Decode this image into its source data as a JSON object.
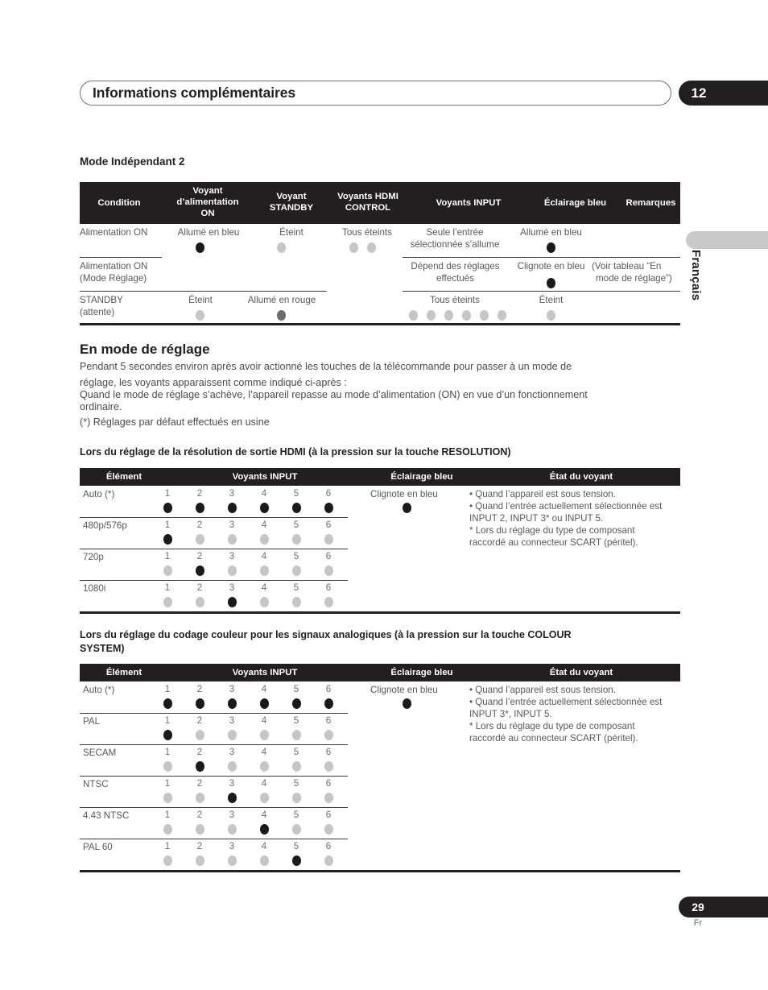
{
  "header": {
    "title": "Informations complémentaires",
    "chapter": "12"
  },
  "side_tab": {
    "language": "Français"
  },
  "footer": {
    "page_number": "29",
    "language_code": "Fr"
  },
  "section_mode_independant": {
    "title": "Mode Indépendant 2",
    "table": {
      "headers": [
        "Condition",
        "Voyant\nd’alimentation\nON",
        "Voyant\nSTANDBY",
        "Voyants HDMI\nCONTROL",
        "Voyants INPUT",
        "Éclairage bleu",
        "Remarques"
      ],
      "header_lines": {
        "h0": [
          "Condition"
        ],
        "h1": [
          "Voyant",
          "d’alimentation",
          "ON"
        ],
        "h2": [
          "Voyant",
          "STANDBY"
        ],
        "h3": [
          "Voyants HDMI",
          "CONTROL"
        ],
        "h4": [
          "Voyants INPUT"
        ],
        "h5": [
          "Éclairage bleu"
        ],
        "h6": [
          "Remarques"
        ]
      },
      "rows": [
        {
          "condition": [
            "Alimentation ON"
          ],
          "power": "Allumé en bleu",
          "standby": "Éteint",
          "hdmi": "Tous éteints",
          "input": [
            "Seule l’entrée",
            "sélectionnée s’allume"
          ],
          "blue": "Allumé en bleu",
          "remarks": [
            ""
          ],
          "power_dot": "on",
          "standby_dot": "off",
          "hdmi_dots": [
            "off",
            "off"
          ],
          "input_dots": [],
          "blue_dot": "on"
        },
        {
          "condition": [
            "Alimentation ON",
            "(Mode Réglage)"
          ],
          "power": "",
          "standby": "",
          "hdmi": "",
          "input": [
            "Dépend des réglages",
            "effectués"
          ],
          "blue": "Clignote en bleu",
          "remarks": [
            "(Voir tableau “En",
            "mode de réglage”)"
          ],
          "power_dot": "none",
          "standby_dot": "none",
          "hdmi_dots": [],
          "input_dots": [],
          "blue_dot": "on"
        },
        {
          "condition": [
            "STANDBY",
            "(attente)"
          ],
          "power": "Éteint",
          "standby": "Allumé en rouge",
          "hdmi": "",
          "input": [
            "Tous éteints"
          ],
          "blue": "Éteint",
          "remarks": [
            ""
          ],
          "power_dot": "off",
          "standby_dot": "red",
          "hdmi_dots": [],
          "input_dots": [
            "off",
            "off",
            "off",
            "off",
            "off",
            "off"
          ],
          "blue_dot": "off"
        }
      ]
    }
  },
  "section_en_mode_de_reglage": {
    "title": "En mode de réglage",
    "paragraph_lines": [
      "Pendant 5 secondes environ après avoir actionné les touches de la télécommande pour passer à un mode de",
      "réglage, les voyants apparaissent comme indiqué ci-après :",
      "Quand le mode de réglage s’achève, l’appareil repasse au mode d’alimentation (ON) en vue d’un fonctionnement",
      "ordinaire.",
      "(*) Réglages par défaut effectués en usine"
    ]
  },
  "section_resolution": {
    "title_lines": [
      "Lors du réglage de la résolution de sortie HDMI (à la pression sur la touche RESOLUTION)"
    ],
    "table": {
      "headers": [
        "Élément",
        "Voyants INPUT",
        "Éclairage bleu",
        "État du voyant"
      ],
      "input_numbers": [
        "1",
        "2",
        "3",
        "4",
        "5",
        "6"
      ],
      "rows": [
        {
          "label": "Auto (*)",
          "dots": [
            "on",
            "on",
            "on",
            "on",
            "on",
            "on"
          ]
        },
        {
          "label": "480p/576p",
          "dots": [
            "on",
            "off",
            "off",
            "off",
            "off",
            "off"
          ]
        },
        {
          "label": "720p",
          "dots": [
            "off",
            "on",
            "off",
            "off",
            "off",
            "off"
          ]
        },
        {
          "label": "1080i",
          "dots": [
            "off",
            "off",
            "on",
            "off",
            "off",
            "off"
          ]
        }
      ],
      "blue_label": "Clignote en bleu",
      "blue_dot": "on",
      "state_lines": [
        "• Quand l’appareil est sous tension.",
        "• Quand l’entrée actuellement sélectionnée est",
        "INPUT 2, INPUT 3* ou INPUT 5.",
        "* Lors du réglage du type de composant",
        "raccordé au connecteur SCART (péritel)."
      ]
    }
  },
  "section_colour_system": {
    "title_lines": [
      "Lors du réglage du codage couleur pour les signaux analogiques (à la pression sur la touche COLOUR",
      "SYSTEM)"
    ],
    "table": {
      "headers": [
        "Élément",
        "Voyants INPUT",
        "Éclairage bleu",
        "État du voyant"
      ],
      "input_numbers": [
        "1",
        "2",
        "3",
        "4",
        "5",
        "6"
      ],
      "rows": [
        {
          "label": "Auto (*)",
          "dots": [
            "on",
            "on",
            "on",
            "on",
            "on",
            "on"
          ]
        },
        {
          "label": "PAL",
          "dots": [
            "on",
            "off",
            "off",
            "off",
            "off",
            "off"
          ]
        },
        {
          "label": "SECAM",
          "dots": [
            "off",
            "on",
            "off",
            "off",
            "off",
            "off"
          ]
        },
        {
          "label": "NTSC",
          "dots": [
            "off",
            "off",
            "on",
            "off",
            "off",
            "off"
          ]
        },
        {
          "label": "4.43 NTSC",
          "dots": [
            "off",
            "off",
            "off",
            "on",
            "off",
            "off"
          ]
        },
        {
          "label": "PAL 60",
          "dots": [
            "off",
            "off",
            "off",
            "off",
            "on",
            "off"
          ]
        }
      ],
      "blue_label": "Clignote en bleu",
      "blue_dot": "on",
      "state_lines": [
        "• Quand l’appareil est sous tension.",
        "• Quand l’entrée actuellement sélectionnée est",
        "INPUT 3*, INPUT 5.",
        "* Lors du réglage du type de composant",
        "raccordé au connecteur SCART (péritel)."
      ]
    }
  },
  "colors": {
    "ink": "#231f20",
    "dot_on": "#1a1a1a",
    "dot_off": "#c6c6c6",
    "dot_red": "#6b6b6b",
    "tab_gray": "#c9c9c9"
  }
}
